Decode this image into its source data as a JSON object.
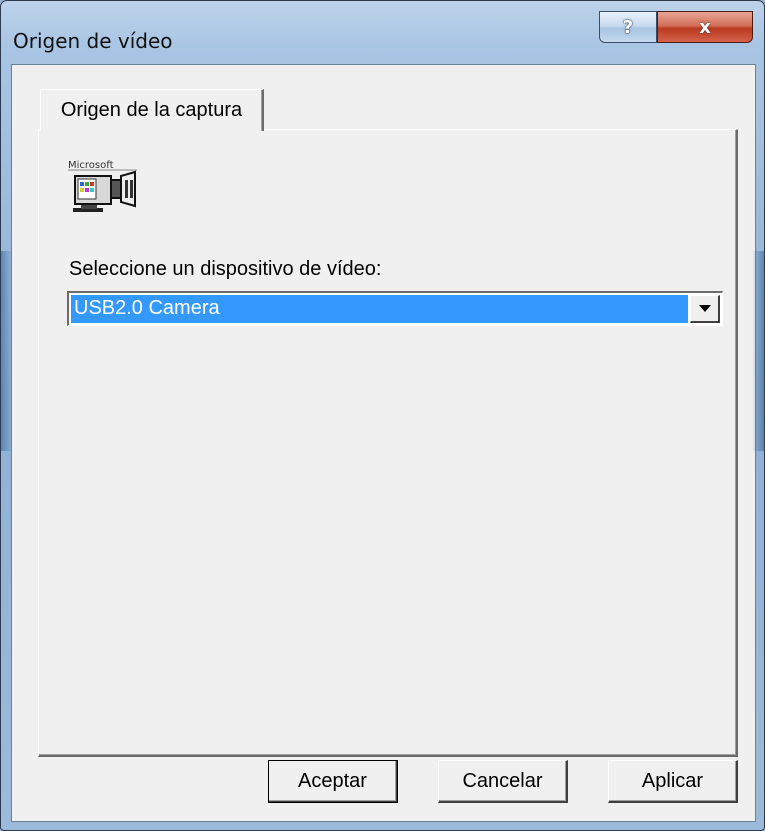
{
  "window": {
    "title": "Origen de vídeo",
    "help_label": "?",
    "close_label": "x"
  },
  "tab": {
    "label": "Origen de la captura"
  },
  "panel": {
    "icon_caption": "Microsoft",
    "device_label": "Seleccione un dispositivo de vídeo:",
    "device_selected": "USB2.0 Camera"
  },
  "buttons": {
    "ok": "Aceptar",
    "cancel": "Cancelar",
    "apply": "Aplicar"
  },
  "colors": {
    "selection": "#3399ff",
    "close_red": "#c6432a",
    "face": "#f0f0f0"
  },
  "icons": [
    "help-icon",
    "close-icon",
    "video-camera-icon",
    "dropdown-arrow-icon"
  ]
}
